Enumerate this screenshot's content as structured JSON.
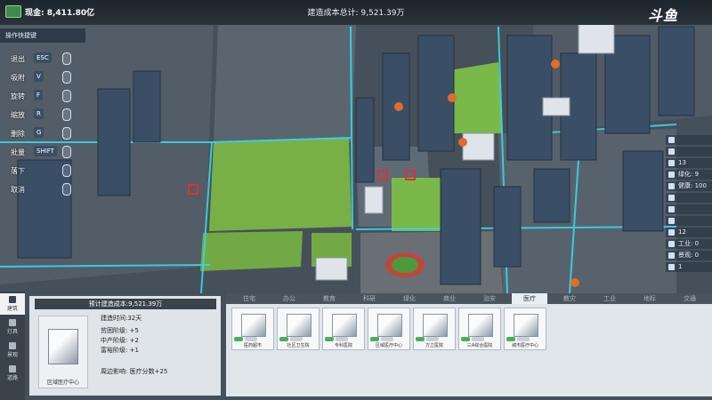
{
  "topbar": {
    "cash_label": "现金: 8,411.80亿",
    "total_cost": "建造成本总计: 9,521.39万",
    "logo": "斗鱼"
  },
  "shortcuts": {
    "title": "操作快捷键",
    "rows": [
      {
        "label": "退出",
        "key": "ESC"
      },
      {
        "label": "吸附",
        "key": "V"
      },
      {
        "label": "旋转",
        "key": "F"
      },
      {
        "label": "缩放",
        "key": "R"
      },
      {
        "label": "删除",
        "key": "G"
      },
      {
        "label": "批量",
        "key": "SHIFT"
      },
      {
        "label": "落下",
        "key": ""
      },
      {
        "label": "取消",
        "key": ""
      }
    ]
  },
  "stats": [
    {
      "label": ""
    },
    {
      "label": ""
    },
    {
      "label": "13"
    },
    {
      "label": "绿化: 9"
    },
    {
      "label": "健康: 100"
    },
    {
      "label": ""
    },
    {
      "label": ""
    },
    {
      "label": ""
    },
    {
      "label": "12"
    },
    {
      "label": "工业: 0"
    },
    {
      "label": "景观: 0"
    },
    {
      "label": "1"
    }
  ],
  "side_nav": [
    {
      "label": "建筑",
      "active": true
    },
    {
      "label": "灯具",
      "active": false
    },
    {
      "label": "景观",
      "active": false
    },
    {
      "label": "道路",
      "active": false
    }
  ],
  "detail": {
    "header": "预计建造成本:9,521.39万",
    "name": "区域医疗中心",
    "lines": [
      "建造时间:32天",
      "贫困阶级: +5",
      "中产阶级: +2",
      "富裕阶级: +1",
      "周边影响: 医疗分数+25"
    ]
  },
  "tabs": [
    "住宅",
    "办公",
    "教育",
    "科研",
    "绿化",
    "商业",
    "治安",
    "医疗",
    "教灾",
    "工业",
    "地标",
    "交通"
  ],
  "active_tab": "医疗",
  "buildings": [
    "医药超市",
    "社区卫生院",
    "专科医院",
    "区域医疗中心",
    "方立医院",
    "三A综合医院",
    "城市医疗中心"
  ],
  "colors": {
    "road_glow": "#39d6ea",
    "grass": "#79b54a",
    "block": "#5b6670"
  }
}
